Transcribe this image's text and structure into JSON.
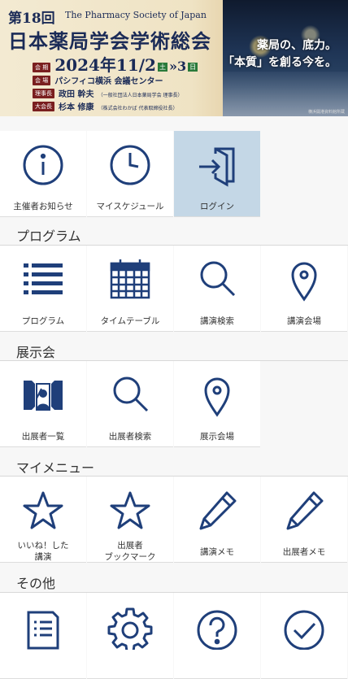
{
  "banner": {
    "edition": "第18回",
    "society_en": "The Pharmacy Society of Japan",
    "title": "日本薬局学会学術総会",
    "period_tag": "会 期",
    "date_main": "2024年11/2",
    "date_sat": "土",
    "date_arrow": "»3",
    "date_sun": "日",
    "venue_tag": "会 場",
    "venue": "パシフィコ横浜 会議センター",
    "chair_tag": "理事長",
    "chair_name": "政田 幹夫",
    "chair_org": "（一般社団法人日本薬局学会 理事長）",
    "president_tag": "大会長",
    "president_name": "杉本 修康",
    "president_org": "（株式会社わかば 代表取締役社長）",
    "catch_line1": "薬局の、底力。",
    "catch_line2_q": "本質",
    "catch_line2_rest": "を創る今を。",
    "credit": "横浜開港資料館所蔵"
  },
  "top_menu": [
    {
      "label": "主催者お知らせ",
      "icon": "info-icon"
    },
    {
      "label": "マイスケジュール",
      "icon": "clock-icon"
    },
    {
      "label": "ログイン",
      "icon": "login-icon"
    }
  ],
  "sections": {
    "program": {
      "title": "プログラム",
      "items": [
        {
          "label": "プログラム",
          "icon": "list-icon"
        },
        {
          "label": "タイムテーブル",
          "icon": "calendar-grid-icon"
        },
        {
          "label": "講演検索",
          "icon": "search-icon"
        },
        {
          "label": "講演会場",
          "icon": "map-pin-icon"
        }
      ]
    },
    "exhibition": {
      "title": "展示会",
      "items": [
        {
          "label": "出展者一覧",
          "icon": "exhibitor-icon"
        },
        {
          "label": "出展者検索",
          "icon": "search-icon"
        },
        {
          "label": "展示会場",
          "icon": "map-pin-icon"
        }
      ]
    },
    "mymenu": {
      "title": "マイメニュー",
      "items": [
        {
          "label": "いいね！した\n講演",
          "icon": "star-icon"
        },
        {
          "label": "出展者\nブックマーク",
          "icon": "star-icon"
        },
        {
          "label": "講演メモ",
          "icon": "pencil-icon"
        },
        {
          "label": "出展者メモ",
          "icon": "pencil-icon"
        }
      ]
    },
    "other": {
      "title": "その他",
      "items": [
        {
          "icon": "document-icon"
        },
        {
          "icon": "gear-icon"
        },
        {
          "icon": "help-icon"
        },
        {
          "icon": "check-circle-icon"
        }
      ]
    }
  },
  "colors": {
    "icon": "#1f3f7a",
    "active_tile": "#c4d7e6"
  }
}
